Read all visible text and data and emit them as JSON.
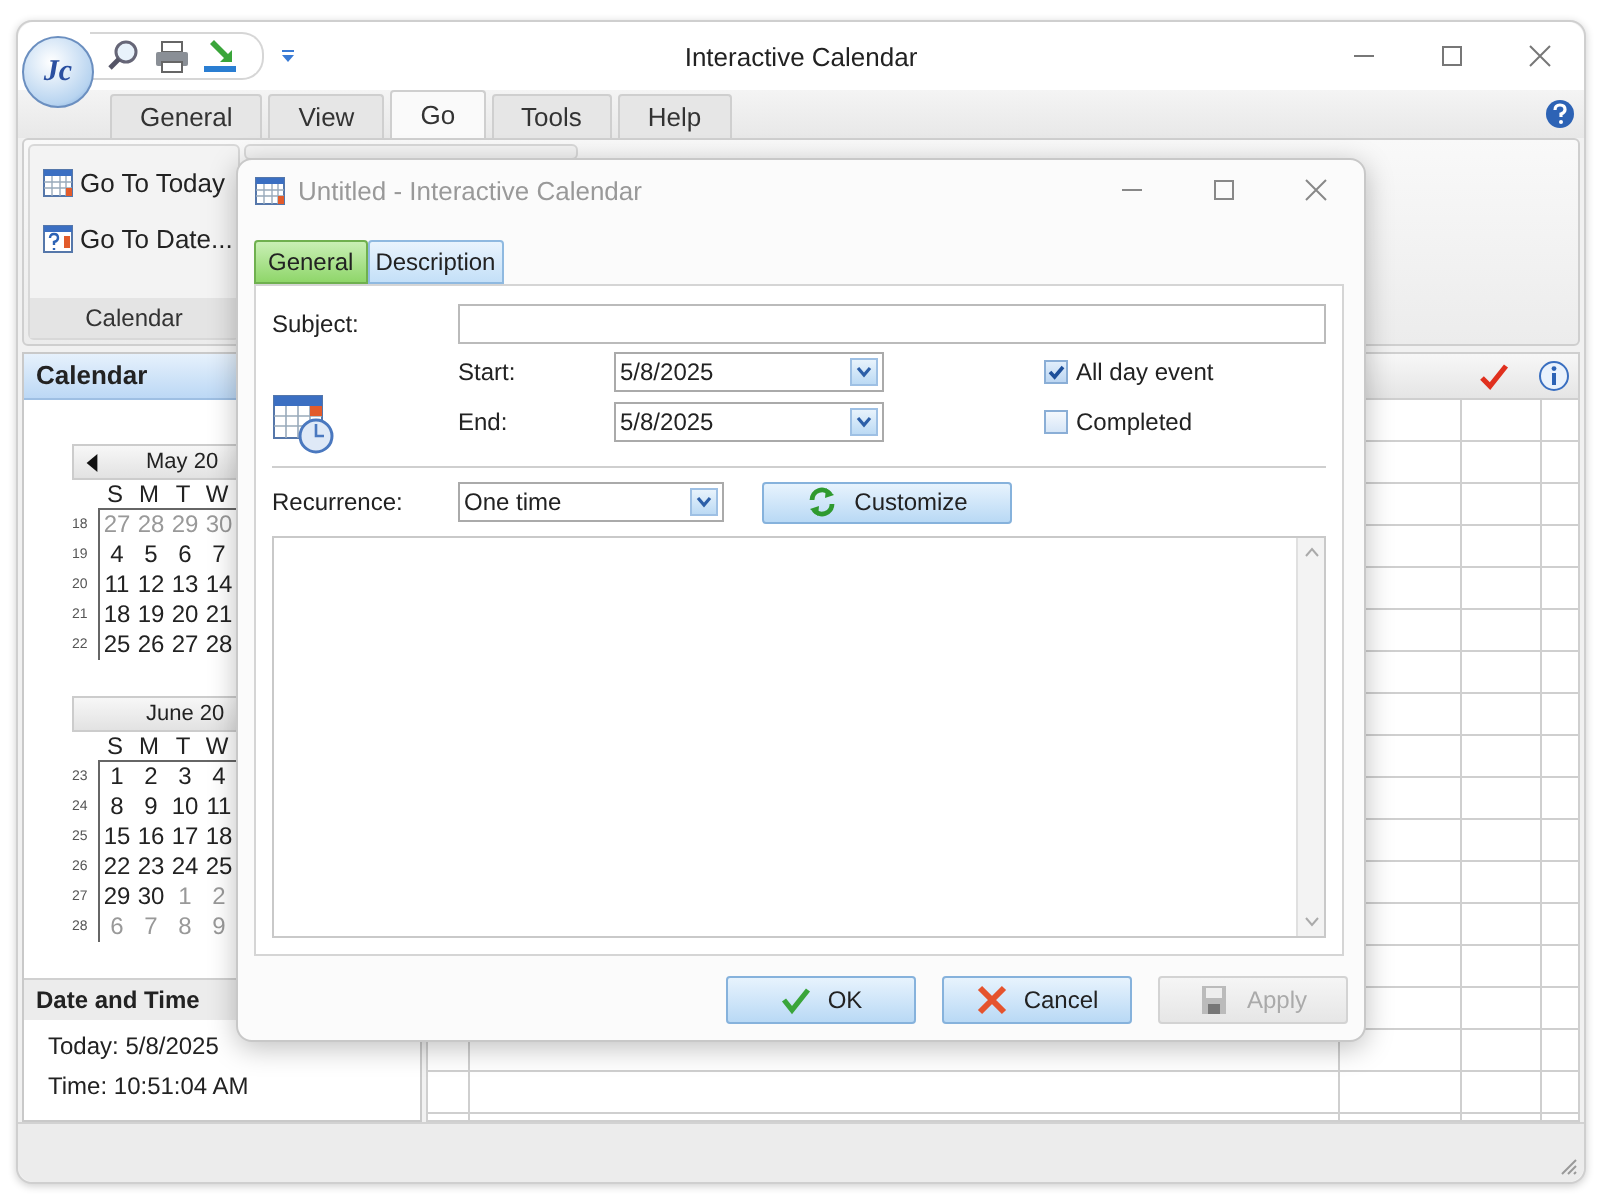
{
  "window": {
    "title": "Interactive Calendar",
    "logo": "Jc"
  },
  "ribbon_tabs": [
    {
      "label": "General",
      "selected": false
    },
    {
      "label": "View",
      "selected": false
    },
    {
      "label": "Go",
      "selected": true
    },
    {
      "label": "Tools",
      "selected": false
    },
    {
      "label": "Help",
      "selected": false
    }
  ],
  "ribbon_group": {
    "label": "Calendar",
    "buttons": [
      {
        "label": "Go To Today",
        "kind": "today"
      },
      {
        "label": "Go To Date...",
        "kind": "date"
      }
    ]
  },
  "calendar_pane": {
    "title": "Calendar",
    "months": [
      {
        "title": "May 20",
        "prev_arrow": true,
        "weekdays": [
          "S",
          "M",
          "T",
          "W"
        ],
        "weeks": [
          {
            "number": "18",
            "days": [
              {
                "text": "27",
                "muted": true
              },
              {
                "text": "28",
                "muted": true
              },
              {
                "text": "29",
                "muted": true
              },
              {
                "text": "30",
                "muted": true
              }
            ]
          },
          {
            "number": "19",
            "days": [
              {
                "text": "4",
                "muted": false
              },
              {
                "text": "5",
                "muted": false
              },
              {
                "text": "6",
                "muted": false
              },
              {
                "text": "7",
                "muted": false
              }
            ]
          },
          {
            "number": "20",
            "days": [
              {
                "text": "11",
                "muted": false
              },
              {
                "text": "12",
                "muted": false
              },
              {
                "text": "13",
                "muted": false
              },
              {
                "text": "14",
                "muted": false
              }
            ]
          },
          {
            "number": "21",
            "days": [
              {
                "text": "18",
                "muted": false
              },
              {
                "text": "19",
                "muted": false
              },
              {
                "text": "20",
                "muted": false
              },
              {
                "text": "21",
                "muted": false
              }
            ]
          },
          {
            "number": "22",
            "days": [
              {
                "text": "25",
                "muted": false
              },
              {
                "text": "26",
                "muted": false
              },
              {
                "text": "27",
                "muted": false
              },
              {
                "text": "28",
                "muted": false
              }
            ]
          }
        ]
      },
      {
        "title": "June 20",
        "prev_arrow": false,
        "weekdays": [
          "S",
          "M",
          "T",
          "W"
        ],
        "weeks": [
          {
            "number": "23",
            "days": [
              {
                "text": "1",
                "muted": false
              },
              {
                "text": "2",
                "muted": false
              },
              {
                "text": "3",
                "muted": false
              },
              {
                "text": "4",
                "muted": false
              }
            ]
          },
          {
            "number": "24",
            "days": [
              {
                "text": "8",
                "muted": false
              },
              {
                "text": "9",
                "muted": false
              },
              {
                "text": "10",
                "muted": false
              },
              {
                "text": "11",
                "muted": false
              }
            ]
          },
          {
            "number": "25",
            "days": [
              {
                "text": "15",
                "muted": false
              },
              {
                "text": "16",
                "muted": false
              },
              {
                "text": "17",
                "muted": false
              },
              {
                "text": "18",
                "muted": false
              }
            ]
          },
          {
            "number": "26",
            "days": [
              {
                "text": "22",
                "muted": false
              },
              {
                "text": "23",
                "muted": false
              },
              {
                "text": "24",
                "muted": false
              },
              {
                "text": "25",
                "muted": false
              }
            ]
          },
          {
            "number": "27",
            "days": [
              {
                "text": "29",
                "muted": false
              },
              {
                "text": "30",
                "muted": false
              },
              {
                "text": "1",
                "muted": true
              },
              {
                "text": "2",
                "muted": true
              }
            ]
          },
          {
            "number": "28",
            "days": [
              {
                "text": "6",
                "muted": true
              },
              {
                "text": "7",
                "muted": true
              },
              {
                "text": "8",
                "muted": true
              },
              {
                "text": "9",
                "muted": true
              }
            ]
          }
        ]
      }
    ]
  },
  "date_time": {
    "title": "Date and Time",
    "lines": [
      "Today: 5/8/2025",
      "Time: 10:51:04 AM"
    ]
  },
  "dialog": {
    "title": "Untitled - Interactive Calendar",
    "tabs": [
      {
        "label": "General",
        "selected": true
      },
      {
        "label": "Description",
        "selected": false
      }
    ],
    "subject_label": "Subject:",
    "start": {
      "label": "Start:",
      "value": "5/8/2025"
    },
    "end": {
      "label": "End:",
      "value": "5/8/2025"
    },
    "checkboxes": [
      {
        "label": "All day event",
        "checked": true
      },
      {
        "label": "Completed",
        "checked": false
      }
    ],
    "recurrence": {
      "label": "Recurrence:",
      "value": "One time"
    },
    "customize_button": "Customize",
    "buttons": [
      {
        "label": "OK",
        "kind": "ok",
        "disabled": false
      },
      {
        "label": "Cancel",
        "kind": "cancel",
        "disabled": false
      },
      {
        "label": "Apply",
        "kind": "apply",
        "disabled": true
      }
    ]
  }
}
